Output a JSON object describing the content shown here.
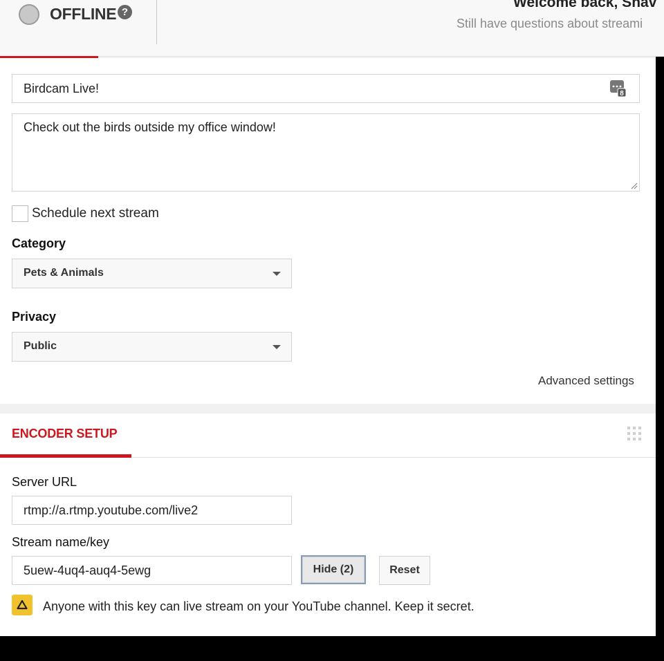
{
  "header": {
    "status": "OFFLINE",
    "help_symbol": "?",
    "welcome": "Welcome back, Shav",
    "questions": "Still have questions about streami"
  },
  "info": {
    "title_value": "Birdcam Live!",
    "emoji_badge": "8",
    "description_value": "Check out the birds outside my office window!",
    "schedule_label": "Schedule next stream",
    "category_label": "Category",
    "category_value": "Pets & Animals",
    "privacy_label": "Privacy",
    "privacy_value": "Public",
    "advanced_link": "Advanced settings"
  },
  "encoder": {
    "title": "ENCODER SETUP",
    "server_url_label": "Server URL",
    "server_url_value": "rtmp://a.rtmp.youtube.com/live2",
    "stream_key_label": "Stream name/key",
    "stream_key_value": "5uew-4uq4-auq4-5ewg",
    "hide_button": "Hide (2)",
    "reset_button": "Reset",
    "warning_symbol": "!",
    "warning_text": "Anyone with this key can live stream on your YouTube channel. Keep it secret."
  },
  "colors": {
    "accent_red": "#cc181e",
    "warning_yellow": "#f2c12e"
  },
  "icons": [
    "status-dot-icon",
    "help-icon",
    "emoji-icon",
    "chevron-down-icon",
    "drag-handle-icon",
    "warning-icon"
  ]
}
